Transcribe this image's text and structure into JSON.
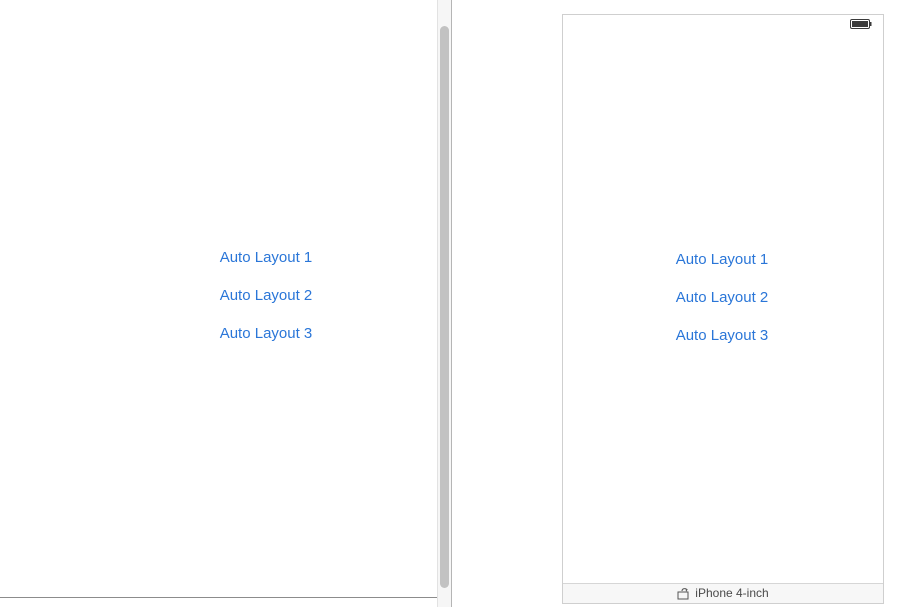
{
  "left_canvas": {
    "buttons": [
      {
        "label": "Auto Layout 1"
      },
      {
        "label": "Auto Layout 2"
      },
      {
        "label": "Auto Layout 3"
      }
    ]
  },
  "preview": {
    "buttons": [
      {
        "label": "Auto Layout 1"
      },
      {
        "label": "Auto Layout 2"
      },
      {
        "label": "Auto Layout 3"
      }
    ],
    "status_bar": {
      "battery_icon": "battery-full-icon"
    },
    "footer": {
      "rotate_icon": "rotate-device-icon",
      "device_label": "iPhone 4-inch"
    }
  },
  "colors": {
    "button_tint": "#2a76d8",
    "scroll_thumb": "#c2c2c2",
    "frame_border": "#cfcfcf"
  }
}
